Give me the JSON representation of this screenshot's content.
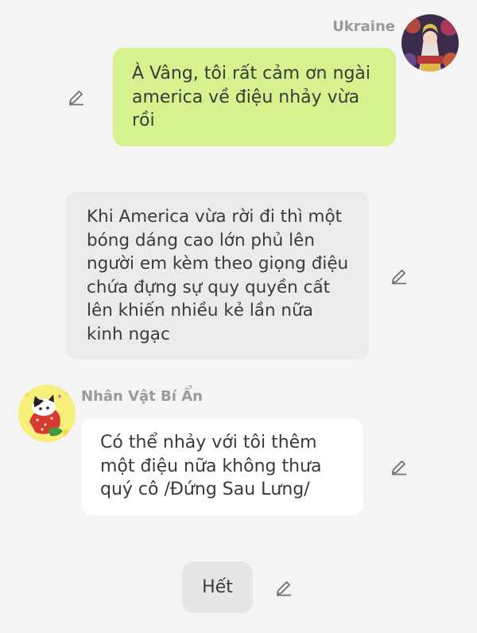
{
  "colors": {
    "background": "#f4f4f4",
    "self_bubble": "#d6f28e",
    "narration_bubble": "#ebebeb",
    "other_bubble": "#ffffff",
    "name_text": "#9a9a9a",
    "message_text": "#3a3a3a"
  },
  "messages": [
    {
      "type": "self",
      "sender": "Ukraine",
      "avatar_icon": "ukraine-avatar-icon",
      "text": "À Vâng, tôi rất cảm ơn ngài america về điệu nhảy vừa rồi"
    },
    {
      "type": "narration",
      "text": "Khi America vừa rời đi thì một bóng dáng cao lớn phủ lên người em kèm theo giọng điệu chứa đựng sự quy quyền cất lên khiến nhiều kẻ lần nữa kinh ngạc"
    },
    {
      "type": "other",
      "sender": "Nhân Vật Bí Ẩn",
      "avatar_icon": "cat-strawberry-avatar-icon",
      "text": "Có thể nhảy với tôi thêm một điệu nữa không thưa quý cô /Đứng Sau Lưng/"
    }
  ],
  "end_chip": {
    "label": "Hết"
  },
  "icons": {
    "edit": "pencil-edit-icon"
  }
}
